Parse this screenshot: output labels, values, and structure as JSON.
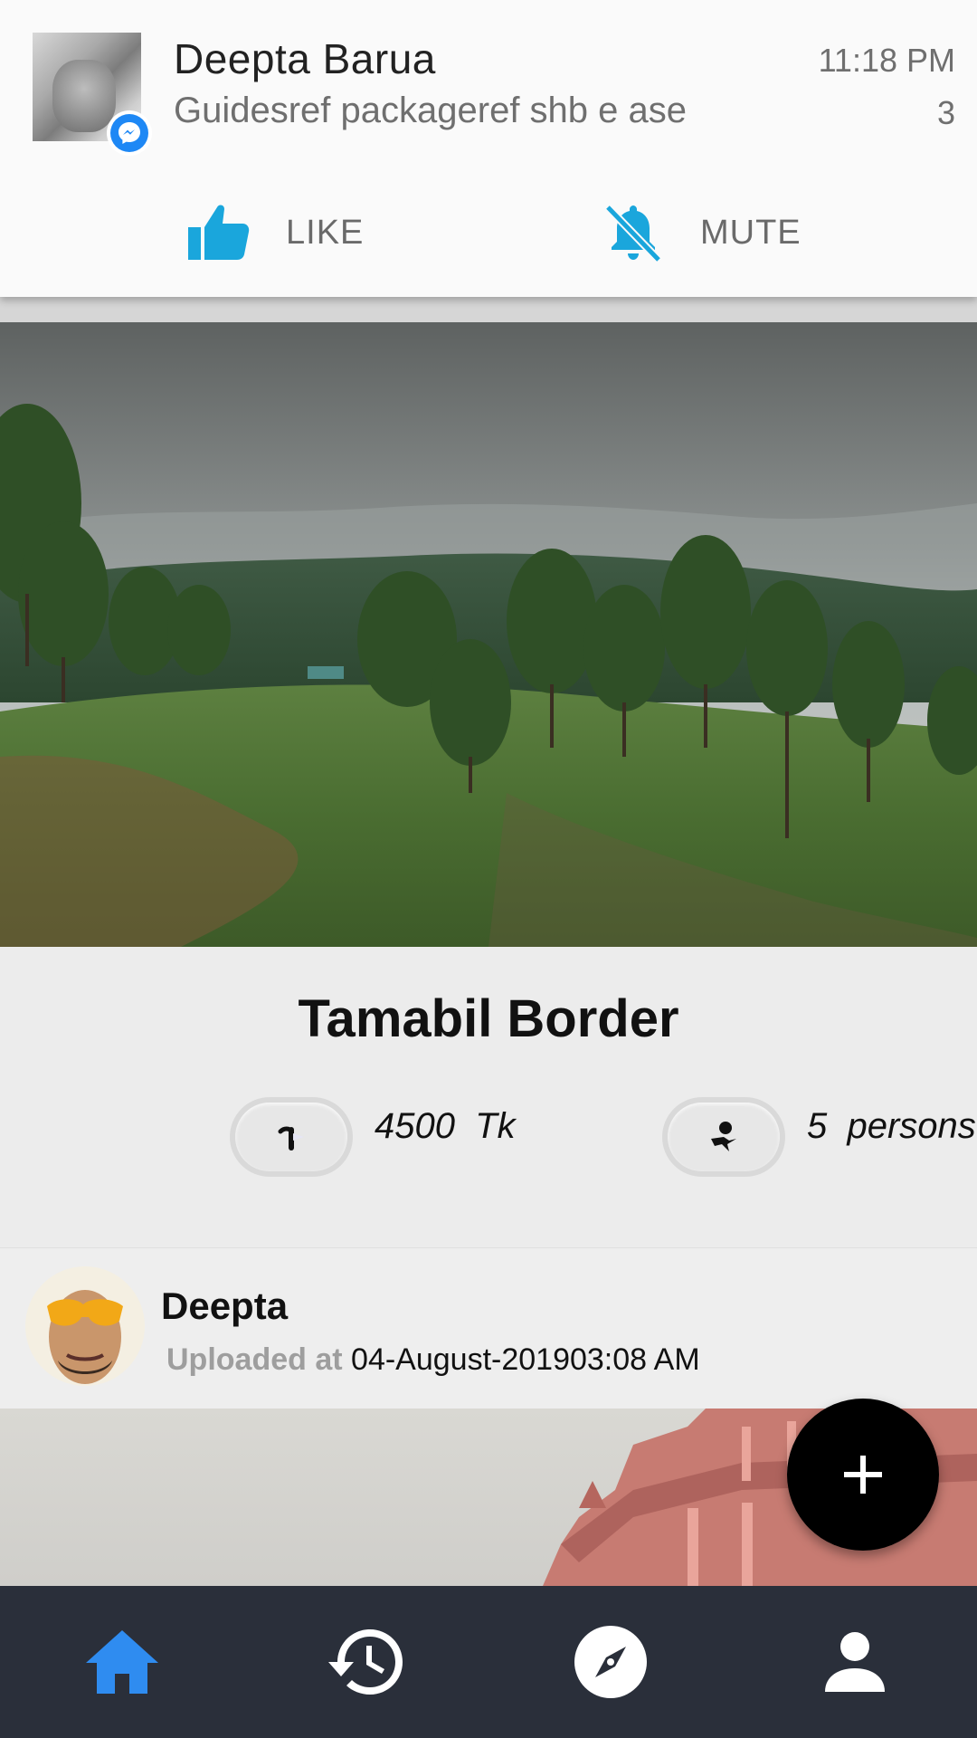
{
  "notification": {
    "sender": "Deepta Barua",
    "message": "Guidesref packageref shb e ase",
    "time": "11:18 PM",
    "count": "3",
    "actions": {
      "like_label": "LIKE",
      "mute_label": "MUTE"
    },
    "badge_icon": "messenger-icon",
    "accent_color": "#1aa6dc"
  },
  "post": {
    "title": "Tamabil Border",
    "price": "4500  Tk",
    "persons": "5  persons",
    "image_icon": "landscape-photo"
  },
  "next_post": {
    "uploader_name": "Deepta",
    "uploaded_label": "Uploaded at",
    "uploaded_value": "04-August-201903:08 AM",
    "image_icon": "building-photo"
  },
  "fab": {
    "icon": "plus-icon"
  },
  "bottom_nav": {
    "items": [
      {
        "icon": "home-icon",
        "active": true
      },
      {
        "icon": "history-icon",
        "active": false
      },
      {
        "icon": "explore-compass-icon",
        "active": false
      },
      {
        "icon": "profile-icon",
        "active": false
      }
    ],
    "active_color": "#2f8cf0",
    "inactive_color": "#ffffff",
    "background": "#2a2f3a"
  }
}
